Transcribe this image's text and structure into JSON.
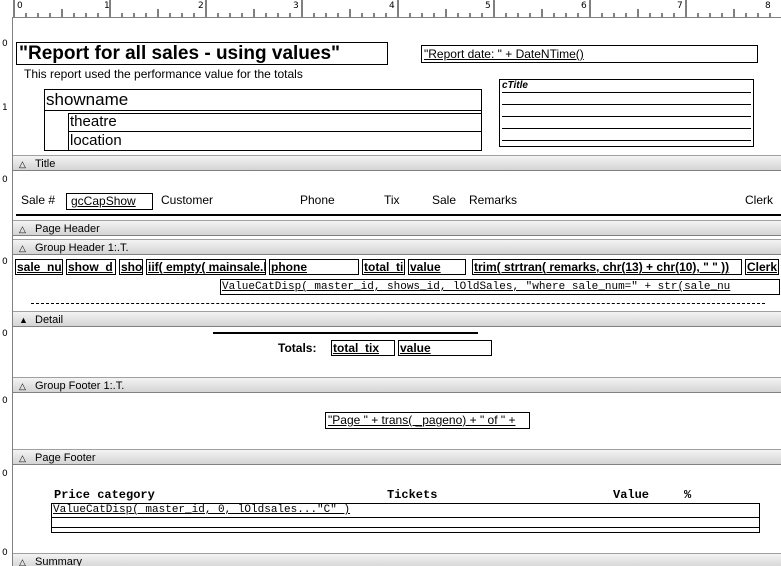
{
  "ruler": {
    "h": [
      "0",
      "1",
      "2",
      "3",
      "4",
      "5",
      "6",
      "7",
      "8"
    ],
    "v": [
      "0",
      "1",
      "0",
      "0",
      "0",
      "0",
      "0",
      "0",
      "0"
    ]
  },
  "title_section": {
    "report_title": "\"Report for all sales - using values\"",
    "report_date_expr": "\"Report date: \" + DateNTime()",
    "subtitle": "This report used the performance value for the totals",
    "showname": "showname",
    "theatre": "theatre",
    "location": "location",
    "ctitle": "cTitle"
  },
  "bands": {
    "title": "Title",
    "page_header": "Page Header",
    "group_header": "Group Header 1:.T.",
    "detail": "Detail",
    "group_footer": "Group Footer 1:.T.",
    "page_footer": "Page Footer",
    "summary": "Summary"
  },
  "page_header": {
    "sale_no": "Sale #",
    "caption": "gcCapShow",
    "customer": "Customer",
    "phone": "Phone",
    "tix": "Tix",
    "sale": "Sale",
    "remarks": "Remarks",
    "clerk": "Clerk"
  },
  "group_header": {
    "sale_num": "sale_nu",
    "show_d": "show_d",
    "sho": "sho",
    "iif": "iif( empty( mainsale.l",
    "phone": "phone",
    "total_ti": "total_ti",
    "value": "value",
    "trim": "trim( strtran( remarks, chr(13) + chr(10), \" \" ))",
    "clerk": "Clerk",
    "valuecat": "ValueCatDisp( master_id, shows_id, lOldSales, \"where sale_num=\" + str(sale_nu"
  },
  "group_footer": {
    "totals_label": "Totals:",
    "total_tix": "total_tix",
    "value": "value"
  },
  "page_footer": {
    "page_expr": "\"Page \" + trans( _pageno) + \" of \" +"
  },
  "summary": {
    "price_category": "Price category",
    "tickets": "Tickets",
    "value": "Value",
    "percent": "%",
    "valuecat": "ValueCatDisp( master_id, 0, lOldsales...\"C\" )"
  }
}
